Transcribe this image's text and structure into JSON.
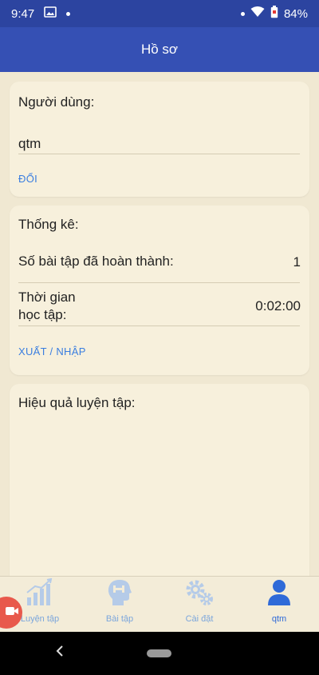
{
  "status_bar": {
    "time": "9:47",
    "battery": "84%"
  },
  "app_bar": {
    "title": "Hồ sơ"
  },
  "user_card": {
    "title": "Người dùng:",
    "username": "qtm",
    "change_label": "ĐỔI"
  },
  "stats_card": {
    "title": "Thống kê:",
    "completed_label": "Số  bài tập đã hoàn thành:",
    "completed_value": "1",
    "study_time_label_line1": "Thời gian",
    "study_time_label_line2": "học tập:",
    "study_time_value": "0:02:00",
    "export_import_label": "XUẤT / NHẬP"
  },
  "effect_card": {
    "title": "Hiệu quả luyện tập:"
  },
  "bottom_nav": {
    "items": [
      {
        "label": "Luyện tập",
        "icon": "chart-bars-icon"
      },
      {
        "label": "Bài tập",
        "icon": "head-dumbbell-icon"
      },
      {
        "label": "Cài đặt",
        "icon": "gears-icon"
      },
      {
        "label": "qtm",
        "icon": "person-icon",
        "active": true
      }
    ]
  },
  "colors": {
    "status_bar": "#2c44a0",
    "app_bar": "#3550b4",
    "background": "#f0e8d2",
    "card": "#f7f0dc",
    "link": "#3a7ee0",
    "nav_inactive": "#7ba6dc",
    "nav_active": "#2f6ad8",
    "record_button": "#e8594c"
  }
}
